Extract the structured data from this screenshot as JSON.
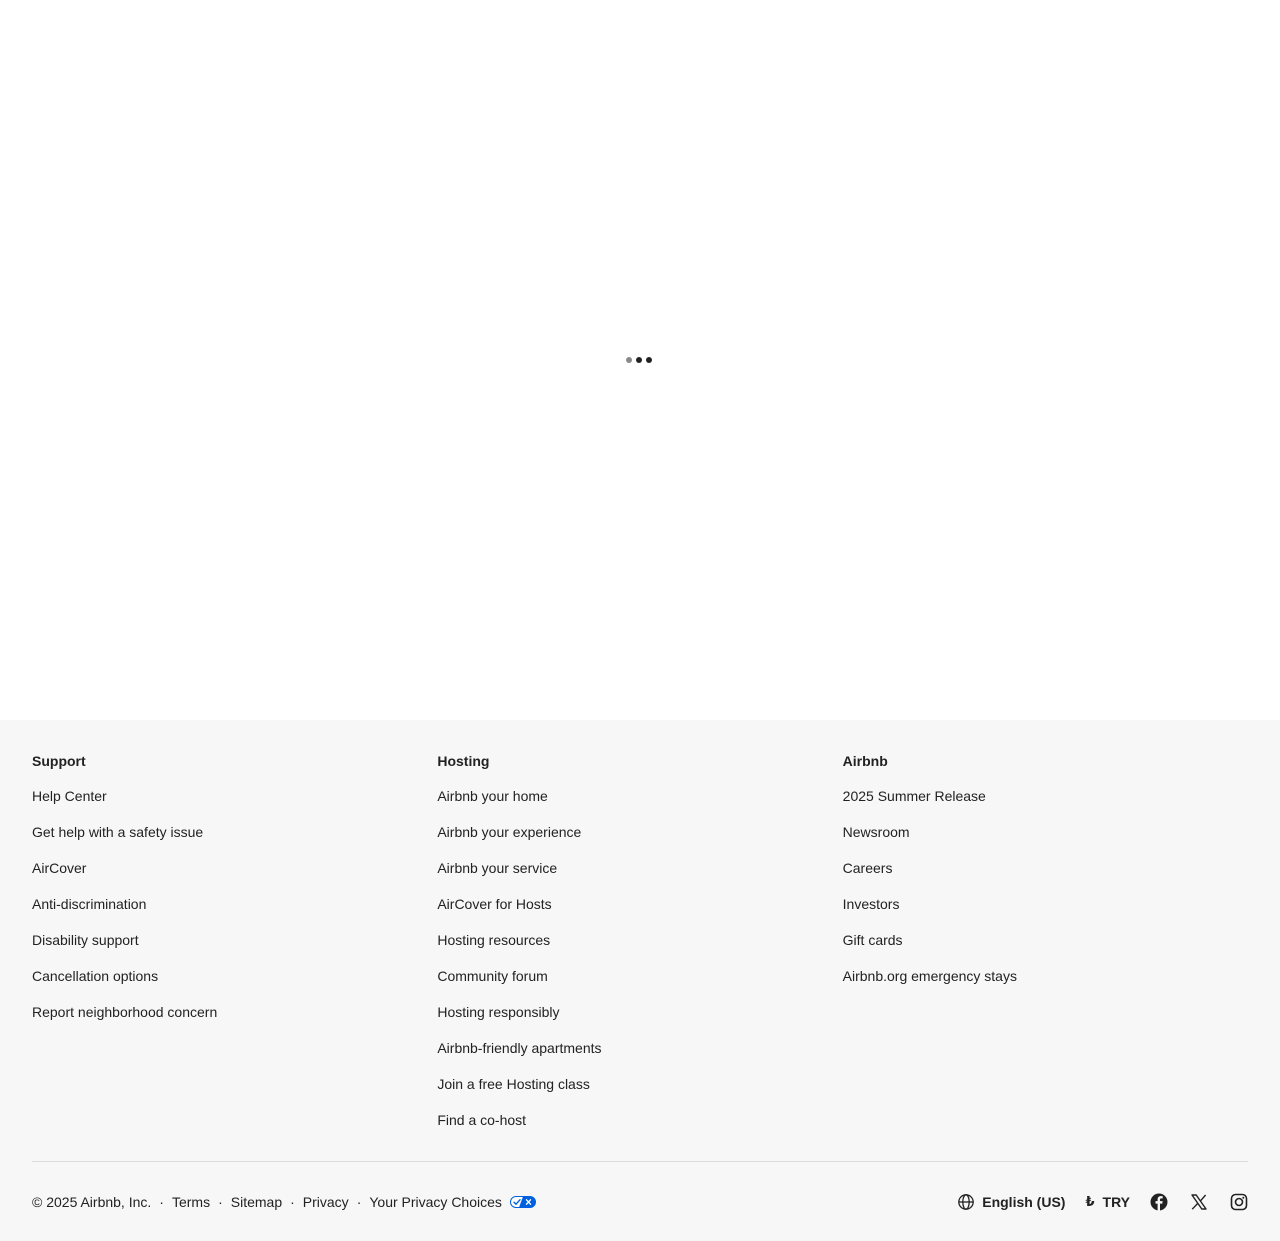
{
  "loading": {
    "dots": 3
  },
  "footer": {
    "columns": [
      {
        "title": "Support",
        "links": [
          "Help Center",
          "Get help with a safety issue",
          "AirCover",
          "Anti-discrimination",
          "Disability support",
          "Cancellation options",
          "Report neighborhood concern"
        ]
      },
      {
        "title": "Hosting",
        "links": [
          "Airbnb your home",
          "Airbnb your experience",
          "Airbnb your service",
          "AirCover for Hosts",
          "Hosting resources",
          "Community forum",
          "Hosting responsibly",
          "Airbnb-friendly apartments",
          "Join a free Hosting class",
          "Find a co-host"
        ]
      },
      {
        "title": "Airbnb",
        "links": [
          "2025 Summer Release",
          "Newsroom",
          "Careers",
          "Investors",
          "Gift cards",
          "Airbnb.org emergency stays"
        ]
      }
    ],
    "legal": {
      "copyright": "© 2025 Airbnb, Inc.",
      "separator": "·",
      "terms": "Terms",
      "sitemap": "Sitemap",
      "privacy": "Privacy",
      "privacy_choices": "Your Privacy Choices"
    },
    "tools": {
      "language": "English (US)",
      "currency_symbol": "₺",
      "currency": "TRY"
    },
    "social_icons": [
      "facebook-icon",
      "x-icon",
      "instagram-icon"
    ],
    "colors": {
      "footer_bg": "#f7f7f7",
      "text": "#222222",
      "privacy_toggle": "#0061e0"
    }
  }
}
